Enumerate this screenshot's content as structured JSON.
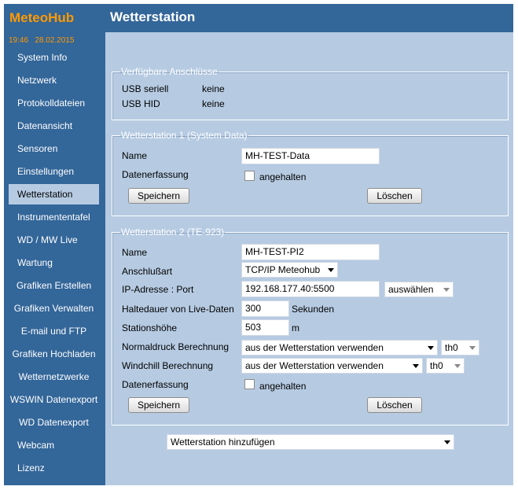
{
  "app": {
    "logo": "MeteoHub",
    "time": "19:46",
    "date": "28.02.2015"
  },
  "nav": [
    {
      "label": "System Info"
    },
    {
      "label": "Netzwerk"
    },
    {
      "label": "Protokolldateien"
    },
    {
      "label": "Datenansicht"
    },
    {
      "label": "Sensoren"
    },
    {
      "label": "Einstellungen"
    },
    {
      "label": "Wetterstation",
      "active": true
    },
    {
      "label": "Instrumententafel"
    },
    {
      "label": "WD / MW Live"
    },
    {
      "label": "Wartung"
    },
    {
      "label": "Grafiken Erstellen"
    },
    {
      "label": "Grafiken Verwalten"
    },
    {
      "label": "E-mail und FTP"
    },
    {
      "label": "Grafiken Hochladen"
    },
    {
      "label": "Wetternetzwerke"
    },
    {
      "label": "WSWIN Datenexport"
    },
    {
      "label": "WD Datenexport"
    },
    {
      "label": "Webcam"
    },
    {
      "label": "Lizenz"
    }
  ],
  "header": {
    "title": "Wetterstation"
  },
  "ports": {
    "legend": "Verfügbare Anschlüsse",
    "rows": [
      {
        "label": "USB seriell",
        "value": "keine"
      },
      {
        "label": "USB HID",
        "value": "keine"
      }
    ]
  },
  "station1": {
    "legend": "Wetterstation 1 (System Data)",
    "name_label": "Name",
    "name_value": "MH-TEST-Data",
    "capture_label": "Datenerfassung",
    "capture_checkbox_label": "angehalten",
    "save_label": "Speichern",
    "delete_label": "Löschen"
  },
  "station2": {
    "legend": "Wetterstation 2 (TE-923)",
    "name_label": "Name",
    "name_value": "MH-TEST-PI2",
    "connection_label": "Anschlußart",
    "connection_value": "TCP/IP Meteohub",
    "ip_label": "IP-Adresse : Port",
    "ip_value": "192.168.177.40:5500",
    "ip_select": "auswählen",
    "hold_label": "Haltedauer von Live-Daten",
    "hold_value": "300",
    "hold_unit": "Sekunden",
    "altitude_label": "Stationshöhe",
    "altitude_value": "503",
    "altitude_unit": "m",
    "pressure_label": "Normaldruck Berechnung",
    "pressure_value": "aus der Wetterstation verwenden",
    "pressure_sensor": "th0",
    "windchill_label": "Windchill Berechnung",
    "windchill_value": "aus der Wetterstation verwenden",
    "windchill_sensor": "th0",
    "capture_label": "Datenerfassung",
    "capture_checkbox_label": "angehalten",
    "save_label": "Speichern",
    "delete_label": "Löschen"
  },
  "add_station": {
    "value": "Wetterstation hinzufügen"
  },
  "colors": {
    "sidebar": "#336699",
    "content": "#b6cbe2",
    "accent": "#ff9900"
  }
}
